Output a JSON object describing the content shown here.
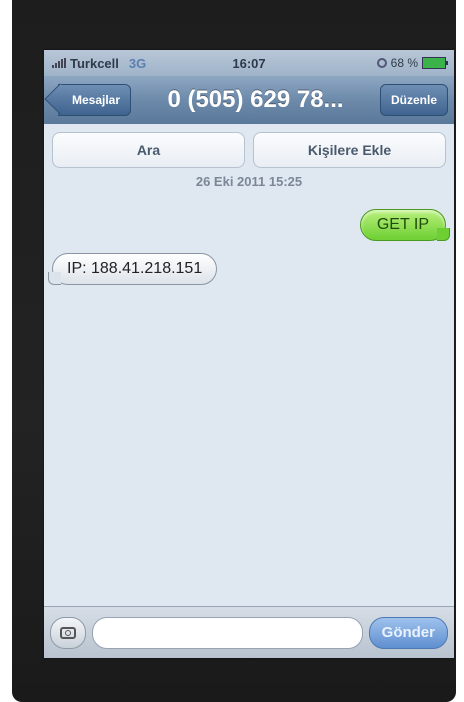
{
  "status_bar": {
    "carrier": "Turkcell",
    "network": "3G",
    "time": "16:07",
    "battery": "68 %"
  },
  "nav": {
    "back_label": "Mesajlar",
    "title": "0 (505) 629 78...",
    "edit_label": "Düzenle"
  },
  "actions": {
    "call_label": "Ara",
    "add_contact_label": "Kişilere Ekle"
  },
  "conversation": {
    "timestamp": "26 Eki 2011 15:25",
    "messages": [
      {
        "direction": "outgoing",
        "text": "GET IP"
      },
      {
        "direction": "incoming",
        "text": "IP: 188.41.218.151"
      }
    ]
  },
  "composer": {
    "camera_icon": "camera-icon",
    "send_label": "Gönder"
  },
  "colors": {
    "outgoing_bubble": "#6dcf32",
    "nav_bar": "#6d8aab",
    "screen_background": "#dfe8f1"
  }
}
